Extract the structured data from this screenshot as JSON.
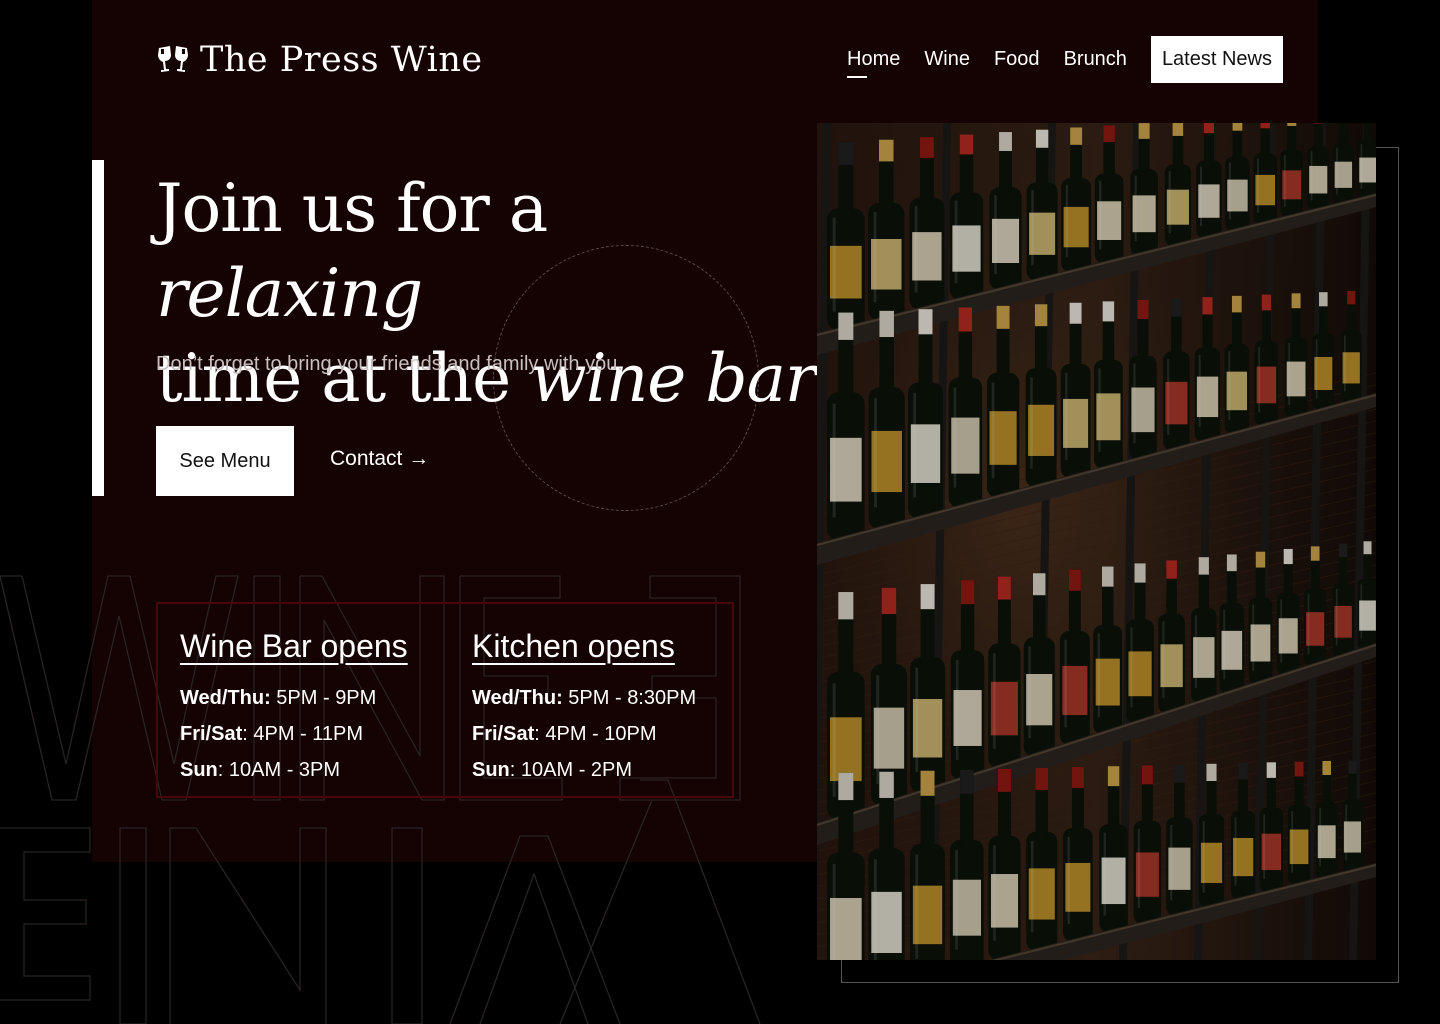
{
  "brand": {
    "name": "The Press Wine",
    "logo_icon": "wine-glasses-icon"
  },
  "nav": {
    "items": [
      {
        "label": "Home",
        "active": true
      },
      {
        "label": "Wine",
        "active": false
      },
      {
        "label": "Food",
        "active": false
      },
      {
        "label": "Brunch",
        "active": false
      }
    ],
    "cta": "Latest News"
  },
  "hero": {
    "title_part1": "Join us for a ",
    "title_italic1": "relaxing",
    "title_part2": "time at the ",
    "title_italic2": "wine bar",
    "subtitle": "Don’t forget to bring your friends and family with you.",
    "primary_button": "See Menu",
    "secondary_button": "Contact →"
  },
  "hours": {
    "wine_bar": {
      "title": "Wine Bar opens",
      "rows": [
        {
          "day": "Wed/Thu:",
          "time": " 5PM - 9PM"
        },
        {
          "day": "Fri/Sat",
          "time": ": 4PM - 11PM"
        },
        {
          "day": "Sun",
          "time": ": 10AM - 3PM"
        }
      ]
    },
    "kitchen": {
      "title": "Kitchen opens",
      "rows": [
        {
          "day": "Wed/Thu:",
          "time": " 5PM - 8:30PM"
        },
        {
          "day": "Fri/Sat",
          "time": ": 4PM - 10PM"
        },
        {
          "day": "Sun",
          "time": ": 10AM - 2PM"
        }
      ]
    }
  },
  "colors": {
    "panel": "#150203",
    "accent": "#8a0c10",
    "background": "#000000"
  }
}
